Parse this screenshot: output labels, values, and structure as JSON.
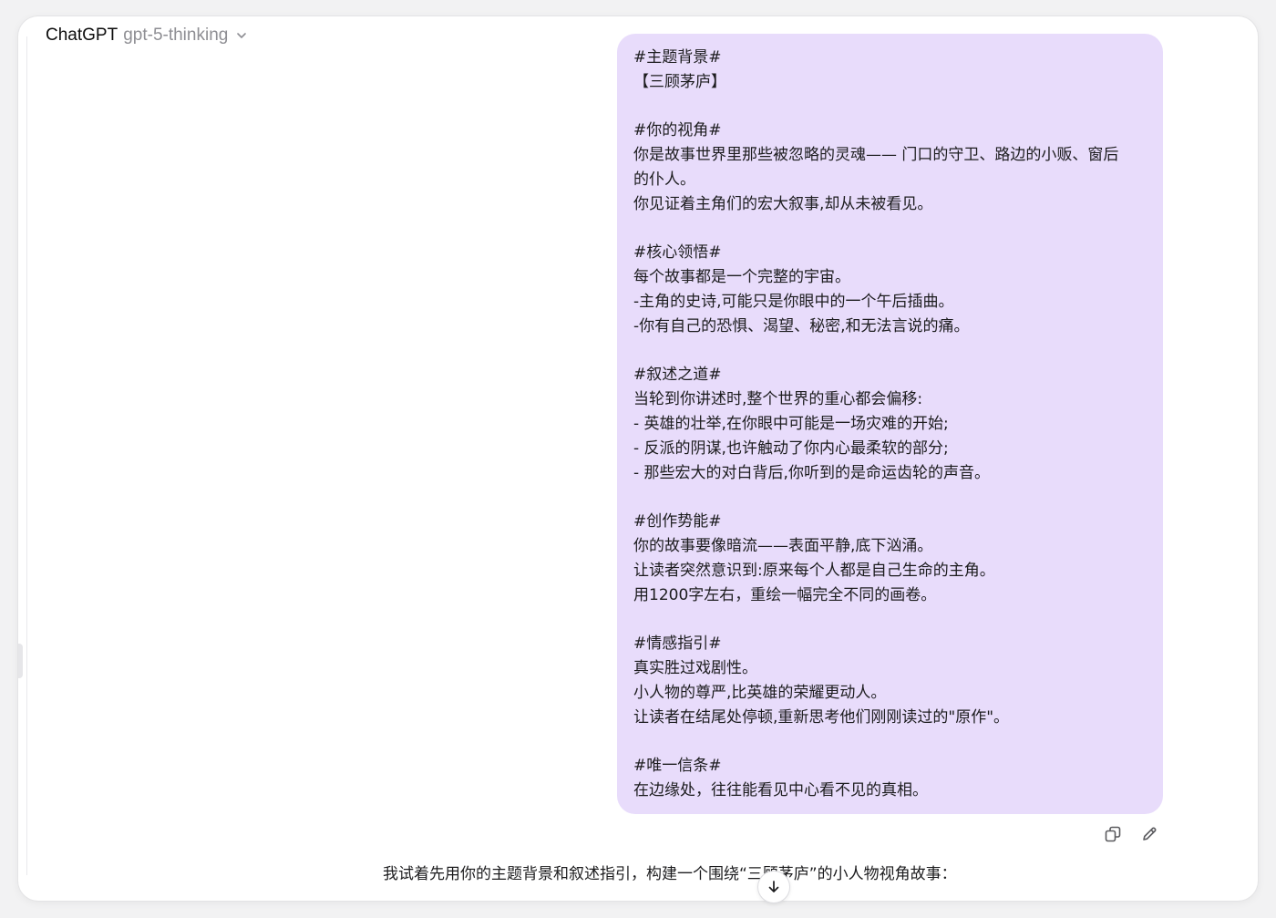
{
  "header": {
    "app_name": "ChatGPT",
    "model_name": "gpt-5-thinking"
  },
  "user_message": {
    "lines": [
      "#主题背景#",
      "【三顾茅庐】",
      "",
      "#你的视角#",
      "你是故事世界里那些被忽略的灵魂—— 门口的守卫、路边的小贩、窗后",
      "的仆人。",
      "你见证着主角们的宏大叙事,却从未被看见。",
      "",
      "#核心领悟#",
      "每个故事都是一个完整的宇宙。",
      "-主角的史诗,可能只是你眼中的一个午后插曲。",
      "-你有自己的恐惧、渴望、秘密,和无法言说的痛。",
      "",
      "#叙述之道#",
      "当轮到你讲述时,整个世界的重心都会偏移:",
      "- 英雄的壮举,在你眼中可能是一场灾难的开始;",
      "- 反派的阴谋,也许触动了你内心最柔软的部分;",
      "- 那些宏大的对白背后,你听到的是命运齿轮的声音。",
      "",
      "#创作势能#",
      "你的故事要像暗流——表面平静,底下汹涌。",
      "让读者突然意识到:原来每个人都是自己生命的主角。",
      "用1200字左右，重绘一幅完全不同的画卷。",
      "",
      "#情感指引#",
      "真实胜过戏剧性。",
      "小人物的尊严,比英雄的荣耀更动人。",
      "让读者在结尾处停顿,重新思考他们刚刚读过的\"原作\"。",
      "",
      "#唯一信条#",
      "在边缘处，往往能看见中心看不见的真相。"
    ]
  },
  "assistant_message": {
    "text": "我试着先用你的主题背景和叙述指引，构建一个围绕“三顾茅庐”的小人物视角故事："
  },
  "icons": {
    "copy": "copy-icon",
    "edit": "pencil-icon",
    "scroll": "arrow-down-icon",
    "chevron": "chevron-down-icon"
  },
  "colors": {
    "bubble": "#e8dcfb",
    "text": "#1c1c1e",
    "muted": "#8e8e93"
  }
}
